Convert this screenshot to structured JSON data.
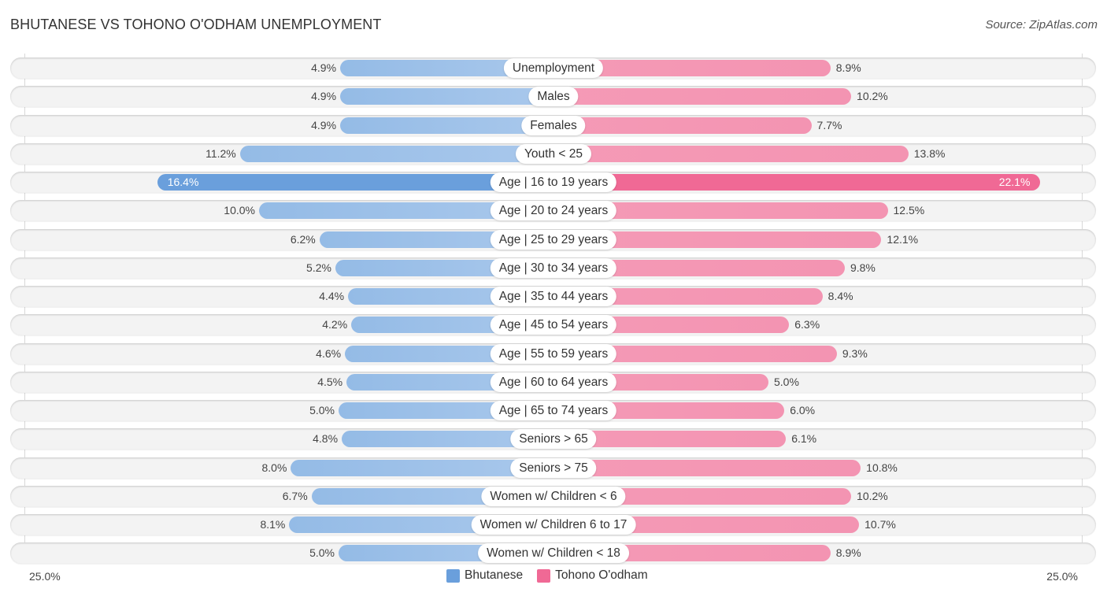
{
  "header": {
    "title": "BHUTANESE VS TOHONO O'ODHAM UNEMPLOYMENT",
    "source": "Source: ZipAtlas.com"
  },
  "legend": {
    "items": [
      {
        "label": "Bhutanese",
        "color": "#6a9fdc"
      },
      {
        "label": "Tohono O'odham",
        "color": "#f06995"
      }
    ]
  },
  "axis": {
    "left_label": "25.0%",
    "right_label": "25.0%"
  },
  "chart_data": {
    "type": "bar",
    "orientation": "horizontal-diverging",
    "title": "BHUTANESE VS TOHONO O'ODHAM UNEMPLOYMENT",
    "xlabel": "",
    "ylabel": "",
    "xlim": [
      0,
      25
    ],
    "tick_labels": [
      "25.0%",
      "25.0%"
    ],
    "legend_position": "bottom-center",
    "categories": [
      "Unemployment",
      "Males",
      "Females",
      "Youth < 25",
      "Age | 16 to 19 years",
      "Age | 20 to 24 years",
      "Age | 25 to 29 years",
      "Age | 30 to 34 years",
      "Age | 35 to 44 years",
      "Age | 45 to 54 years",
      "Age | 55 to 59 years",
      "Age | 60 to 64 years",
      "Age | 65 to 74 years",
      "Seniors > 65",
      "Seniors > 75",
      "Women w/ Children < 6",
      "Women w/ Children 6 to 17",
      "Women w/ Children < 18"
    ],
    "series": [
      {
        "name": "Bhutanese",
        "side": "left",
        "color": "#6a9fdc",
        "values": [
          4.9,
          4.9,
          4.9,
          11.2,
          16.4,
          10.0,
          6.2,
          5.2,
          4.4,
          4.2,
          4.6,
          4.5,
          5.0,
          4.8,
          8.0,
          6.7,
          8.1,
          5.0
        ],
        "labels": [
          "4.9%",
          "4.9%",
          "4.9%",
          "11.2%",
          "16.4%",
          "10.0%",
          "6.2%",
          "5.2%",
          "4.4%",
          "4.2%",
          "4.6%",
          "4.5%",
          "5.0%",
          "4.8%",
          "8.0%",
          "6.7%",
          "8.1%",
          "5.0%"
        ]
      },
      {
        "name": "Tohono O'odham",
        "side": "right",
        "color": "#f06995",
        "values": [
          8.9,
          10.2,
          7.7,
          13.8,
          22.1,
          12.5,
          12.1,
          9.8,
          8.4,
          6.3,
          9.3,
          5.0,
          6.0,
          6.1,
          10.8,
          10.2,
          10.7,
          8.9
        ],
        "labels": [
          "8.9%",
          "10.2%",
          "7.7%",
          "13.8%",
          "22.1%",
          "12.5%",
          "12.1%",
          "9.8%",
          "8.4%",
          "6.3%",
          "9.3%",
          "5.0%",
          "6.0%",
          "6.1%",
          "10.8%",
          "10.2%",
          "10.7%",
          "8.9%"
        ]
      }
    ],
    "highlight_index": 4
  }
}
